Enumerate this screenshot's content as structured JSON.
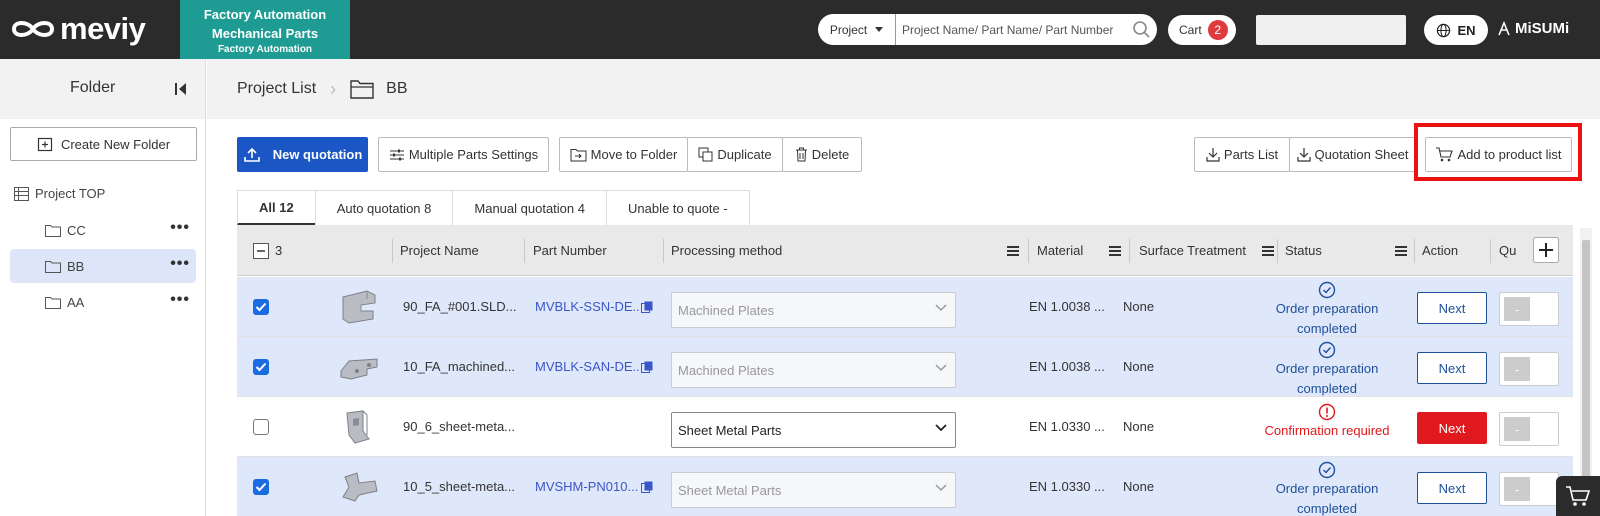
{
  "header": {
    "logo_text": "meviy",
    "fa_line1": "Factory Automation",
    "fa_line2": "Mechanical Parts",
    "fa_line3": "Factory Automation",
    "search_scope": "Project",
    "search_placeholder": "Project Name/ Part Name/ Part Number",
    "cart_label": "Cart",
    "cart_count": "2",
    "language": "EN",
    "brand": "MiSUMi"
  },
  "sidebar": {
    "title": "Folder",
    "create_folder": "Create New Folder",
    "project_top": "Project TOP",
    "folders": [
      "CC",
      "BB",
      "AA"
    ],
    "active_folder": "BB"
  },
  "breadcrumb": {
    "root": "Project List",
    "current": "BB"
  },
  "toolbar": {
    "new_quotation": "New quotation",
    "multiple_parts_settings": "Multiple Parts Settings",
    "move_to_folder": "Move to Folder",
    "duplicate": "Duplicate",
    "delete": "Delete",
    "parts_list": "Parts List",
    "quotation_sheet": "Quotation Sheet",
    "add_to_product_list": "Add to product list"
  },
  "tabs": [
    {
      "label": "All 12"
    },
    {
      "label": "Auto quotation 8"
    },
    {
      "label": "Manual quotation 4"
    },
    {
      "label": "Unable to quote -"
    }
  ],
  "table": {
    "selected_count": "3",
    "columns": {
      "project_name": "Project Name",
      "part_number": "Part Number",
      "processing_method": "Processing method",
      "material": "Material",
      "surface_treatment": "Surface Treatment",
      "status": "Status",
      "action": "Action",
      "quantity": "Qu"
    },
    "rows": [
      {
        "checked": true,
        "project": "90_FA_#001.SLD...",
        "part_number": "MVBLK-SSN-DE...",
        "process": "Machined Plates",
        "material": "EN 1.0038 ...",
        "surface": "None",
        "status": "Order preparation completed",
        "action": "Next",
        "qty_minus": "-"
      },
      {
        "checked": true,
        "project": "10_FA_machined...",
        "part_number": "MVBLK-SAN-DE...",
        "process": "Machined Plates",
        "material": "EN 1.0038 ...",
        "surface": "None",
        "status": "Order preparation completed",
        "action": "Next",
        "qty_minus": "-"
      },
      {
        "checked": false,
        "project": "90_6_sheet-meta...",
        "part_number": "",
        "process": "Sheet Metal Parts",
        "material": "EN 1.0330 ...",
        "surface": "None",
        "status": "Confirmation required",
        "action": "Next",
        "qty_minus": "-"
      },
      {
        "checked": true,
        "project": "10_5_sheet-meta...",
        "part_number": "MVSHM-PN010...",
        "process": "Sheet Metal Parts",
        "material": "EN 1.0330 ...",
        "surface": "None",
        "status": "Order preparation completed",
        "action": "Next",
        "qty_minus": "-"
      }
    ]
  },
  "colors": {
    "topbar": "#2b2b2b",
    "teal": "#1e9b93",
    "primary": "#1a56c4",
    "selected_row": "#dfe8fa",
    "alert_red": "#e0191e",
    "highlight_box": "#ee1111"
  }
}
